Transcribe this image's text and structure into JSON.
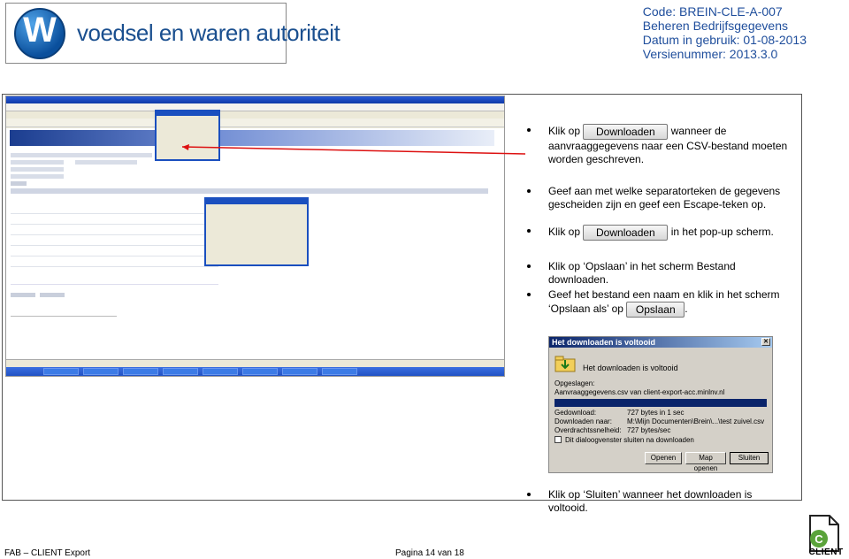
{
  "header": {
    "logo_text": "voedsel en waren autoriteit",
    "code": "Code: BREIN-CLE-A-007",
    "title": "Beheren Bedrijfsgegevens",
    "date": "Datum in gebruik: 01-08-2013",
    "version": "Versienummer: 2013.3.0"
  },
  "instructions": [
    {
      "pre": "Klik op",
      "button": "Downloaden",
      "post": "wanneer de aanvraaggegevens naar een CSV-bestand moeten worden geschreven."
    },
    {
      "text": "Geef aan met welke separatorteken de gegevens gescheiden zijn en geef een Escape-teken op."
    },
    {
      "pre": "Klik op",
      "button": "Downloaden",
      "post": "in het pop-up scherm."
    },
    {
      "text": "Klik op ‘Opslaan’ in het scherm Bestand downloaden."
    },
    {
      "text": "Geef het bestand een naam en klik in het scherm ‘Opslaan als’ op",
      "button": "Opslaan",
      "post": "."
    },
    {
      "text": "Klik op ‘Sluiten’ wanneer het downloaden is voltooid."
    }
  ],
  "download_dialog": {
    "title": "Het downloaden is voltooid",
    "heading": "Het downloaden is voltooid",
    "saved_label": "Opgeslagen:",
    "saved_value": "Aanvraaggegevens.csv van client-export-acc.minlnv.nl",
    "downloaded_label": "Gedownload:",
    "downloaded_value": "727 bytes in 1 sec",
    "target_label": "Downloaden naar:",
    "target_value": "M:\\Mijn Documenten\\Brein\\...\\test zuivel.csv",
    "speed_label": "Overdrachtssnelheid:",
    "speed_value": "727 bytes/sec",
    "checkbox_label": "Dit dialoogvenster sluiten na downloaden",
    "btn_open": "Openen",
    "btn_map": "Map openen",
    "btn_close": "Sluiten"
  },
  "footer": {
    "left": "FAB – CLIENT Export",
    "page": "Pagina 14 van 18",
    "client_logo": "CLIENT"
  },
  "colors": {
    "header_blue": "#1f4e9c",
    "xp_title": "#0a246a"
  }
}
